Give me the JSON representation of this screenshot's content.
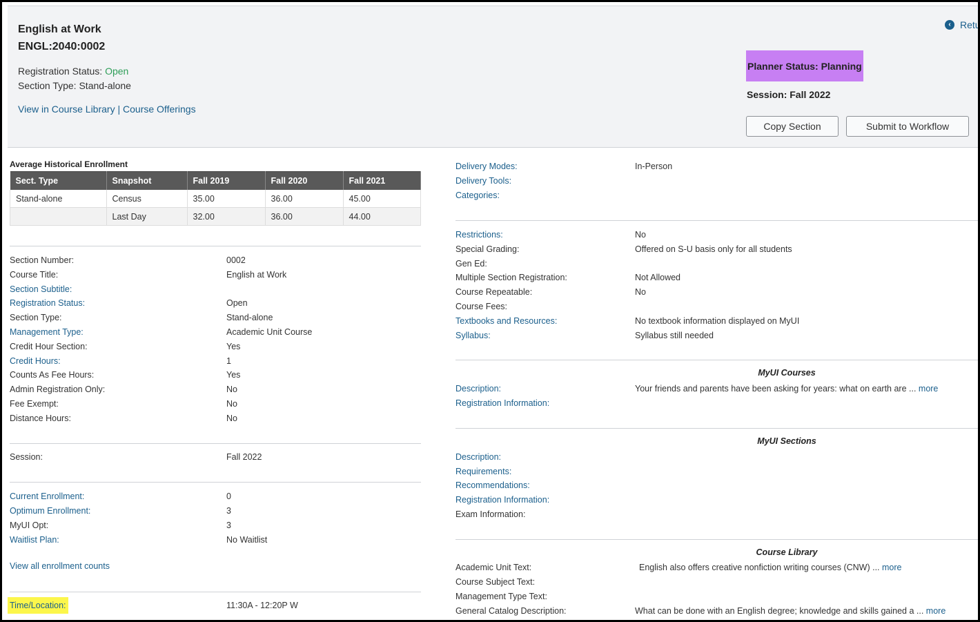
{
  "header": {
    "course_title": "English at Work",
    "course_code": "ENGL:2040:0002",
    "registration_status_label": "Registration Status: ",
    "registration_status_value": "Open",
    "section_type_line": "Section Type: Stand-alone",
    "link_course_library": "View in Course Library",
    "link_separator": " | ",
    "link_course_offerings": "Course Offerings",
    "return_label": "Retu",
    "return_icon": "chevron-left-circle-icon",
    "planner_status": "Planner Status: Planning",
    "session": "Session: Fall 2022",
    "copy_section_label": "Copy Section",
    "submit_workflow_label": "Submit to Workflow",
    "colors": {
      "planner_bg": "#c77ff3",
      "link": "#1b5f8c",
      "open": "#2e9e58"
    }
  },
  "historical": {
    "title": "Average Historical Enrollment",
    "columns": [
      "Sect. Type",
      "Snapshot",
      "Fall 2019",
      "Fall 2020",
      "Fall 2021"
    ],
    "rows": [
      [
        "Stand-alone",
        "Census",
        "35.00",
        "36.00",
        "45.00"
      ],
      [
        "",
        "Last Day",
        "32.00",
        "36.00",
        "44.00"
      ]
    ]
  },
  "left": {
    "section_info": [
      {
        "label": "Section Number:",
        "value": "0002"
      },
      {
        "label": "Course Title:",
        "value": "English at Work"
      },
      {
        "label": "Section Subtitle:",
        "value": ""
      },
      {
        "label": "Registration Status:",
        "value": "Open"
      },
      {
        "label": "Section Type:",
        "value": "Stand-alone"
      },
      {
        "label": "Management Type:",
        "value": "Academic Unit Course"
      },
      {
        "label": "Credit Hour Section:",
        "value": "Yes"
      },
      {
        "label": "Credit Hours:",
        "value": "1"
      },
      {
        "label": "Counts As Fee Hours:",
        "value": "Yes"
      },
      {
        "label": "Admin Registration Only:",
        "value": "No"
      },
      {
        "label": "Fee Exempt:",
        "value": "No"
      },
      {
        "label": "Distance Hours:",
        "value": "No"
      }
    ],
    "session": {
      "label": "Session:",
      "value": "Fall 2022"
    },
    "enrollment": [
      {
        "label": "Current Enrollment:",
        "value": "0"
      },
      {
        "label": "Optimum Enrollment:",
        "value": "3"
      },
      {
        "label": "MyUI Opt:",
        "value": "3"
      },
      {
        "label": "Waitlist Plan:",
        "value": "No Waitlist"
      }
    ],
    "view_all_link": "View all enrollment counts",
    "time_location": {
      "label": "Time/Location:",
      "value": "11:30A - 12:20P W"
    }
  },
  "right": {
    "delivery": [
      {
        "label": "Delivery Modes:",
        "value": "In-Person"
      },
      {
        "label": "Delivery Tools:",
        "value": ""
      },
      {
        "label": "Categories:",
        "value": ""
      }
    ],
    "restrictions": [
      {
        "label": "Restrictions:",
        "value": "No"
      },
      {
        "label": "Special Grading:",
        "value": "Offered on S-U basis only for all students"
      },
      {
        "label": "Gen Ed:",
        "value": ""
      },
      {
        "label": "Multiple Section Registration:",
        "value": "Not Allowed"
      },
      {
        "label": "Course Repeatable:",
        "value": "No"
      },
      {
        "label": "Course Fees:",
        "value": ""
      },
      {
        "label": "Textbooks and Resources:",
        "value": "No textbook information displayed on MyUI"
      },
      {
        "label": "Syllabus:",
        "value": "Syllabus still needed"
      }
    ],
    "myui_courses": {
      "heading": "MyUI Courses",
      "rows": [
        {
          "label": "Description:",
          "value": "Your friends and parents have been asking for years: what on earth are ... ",
          "more": "more"
        },
        {
          "label": "Registration Information:",
          "value": ""
        }
      ]
    },
    "myui_sections": {
      "heading": "MyUI Sections",
      "rows": [
        {
          "label": "Description:"
        },
        {
          "label": "Requirements:"
        },
        {
          "label": "Recommendations:"
        },
        {
          "label": "Registration Information:"
        },
        {
          "label": "Exam Information:"
        }
      ]
    },
    "course_library": {
      "heading": "Course Library",
      "rows": [
        {
          "label": "Academic Unit Text:",
          "value": "English also offers creative nonfiction writing courses (CNW) ... ",
          "more": "more"
        },
        {
          "label": "Course Subject Text:",
          "value": ""
        },
        {
          "label": "Management Type Text:",
          "value": ""
        },
        {
          "label": "General Catalog Description:",
          "value": "What can be done with an English degree; knowledge and skills gained a ... ",
          "more": "more"
        }
      ]
    }
  }
}
